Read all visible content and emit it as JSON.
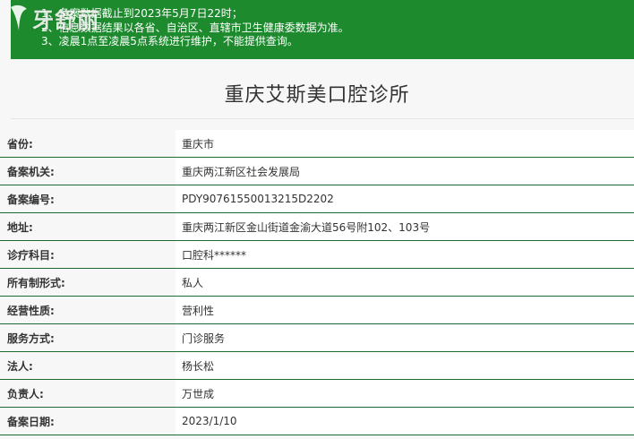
{
  "notice": {
    "lines": [
      "1、备案数据截止到2023年5月7日22时；",
      "2、信息数据结果以各省、自治区、直辖市卫生健康委数据为准。",
      "3、凌晨1点至凌晨5点系统进行维护，不能提供查询。"
    ]
  },
  "watermark": {
    "text": "牙舒丽"
  },
  "page": {
    "title": "重庆艾斯美口腔诊所"
  },
  "fields": [
    {
      "label": "省份:",
      "value": "重庆市"
    },
    {
      "label": "备案机关:",
      "value": "重庆两江新区社会发展局"
    },
    {
      "label": "备案编号:",
      "value": "PDY90761550013215D2202"
    },
    {
      "label": "地址:",
      "value": "重庆两江新区金山街道金渝大道56号附102、103号"
    },
    {
      "label": "诊疗科目:",
      "value": "口腔科******"
    },
    {
      "label": "所有制形式:",
      "value": "私人"
    },
    {
      "label": "经营性质:",
      "value": "营利性"
    },
    {
      "label": "服务方式:",
      "value": "门诊服务"
    },
    {
      "label": "法人:",
      "value": "杨长松"
    },
    {
      "label": "负责人:",
      "value": "万世成"
    },
    {
      "label": "备案日期:",
      "value": "2023/1/10"
    }
  ],
  "colors": {
    "notice_bg": "#1d8a2e",
    "row_border": "#1d6b2f"
  }
}
